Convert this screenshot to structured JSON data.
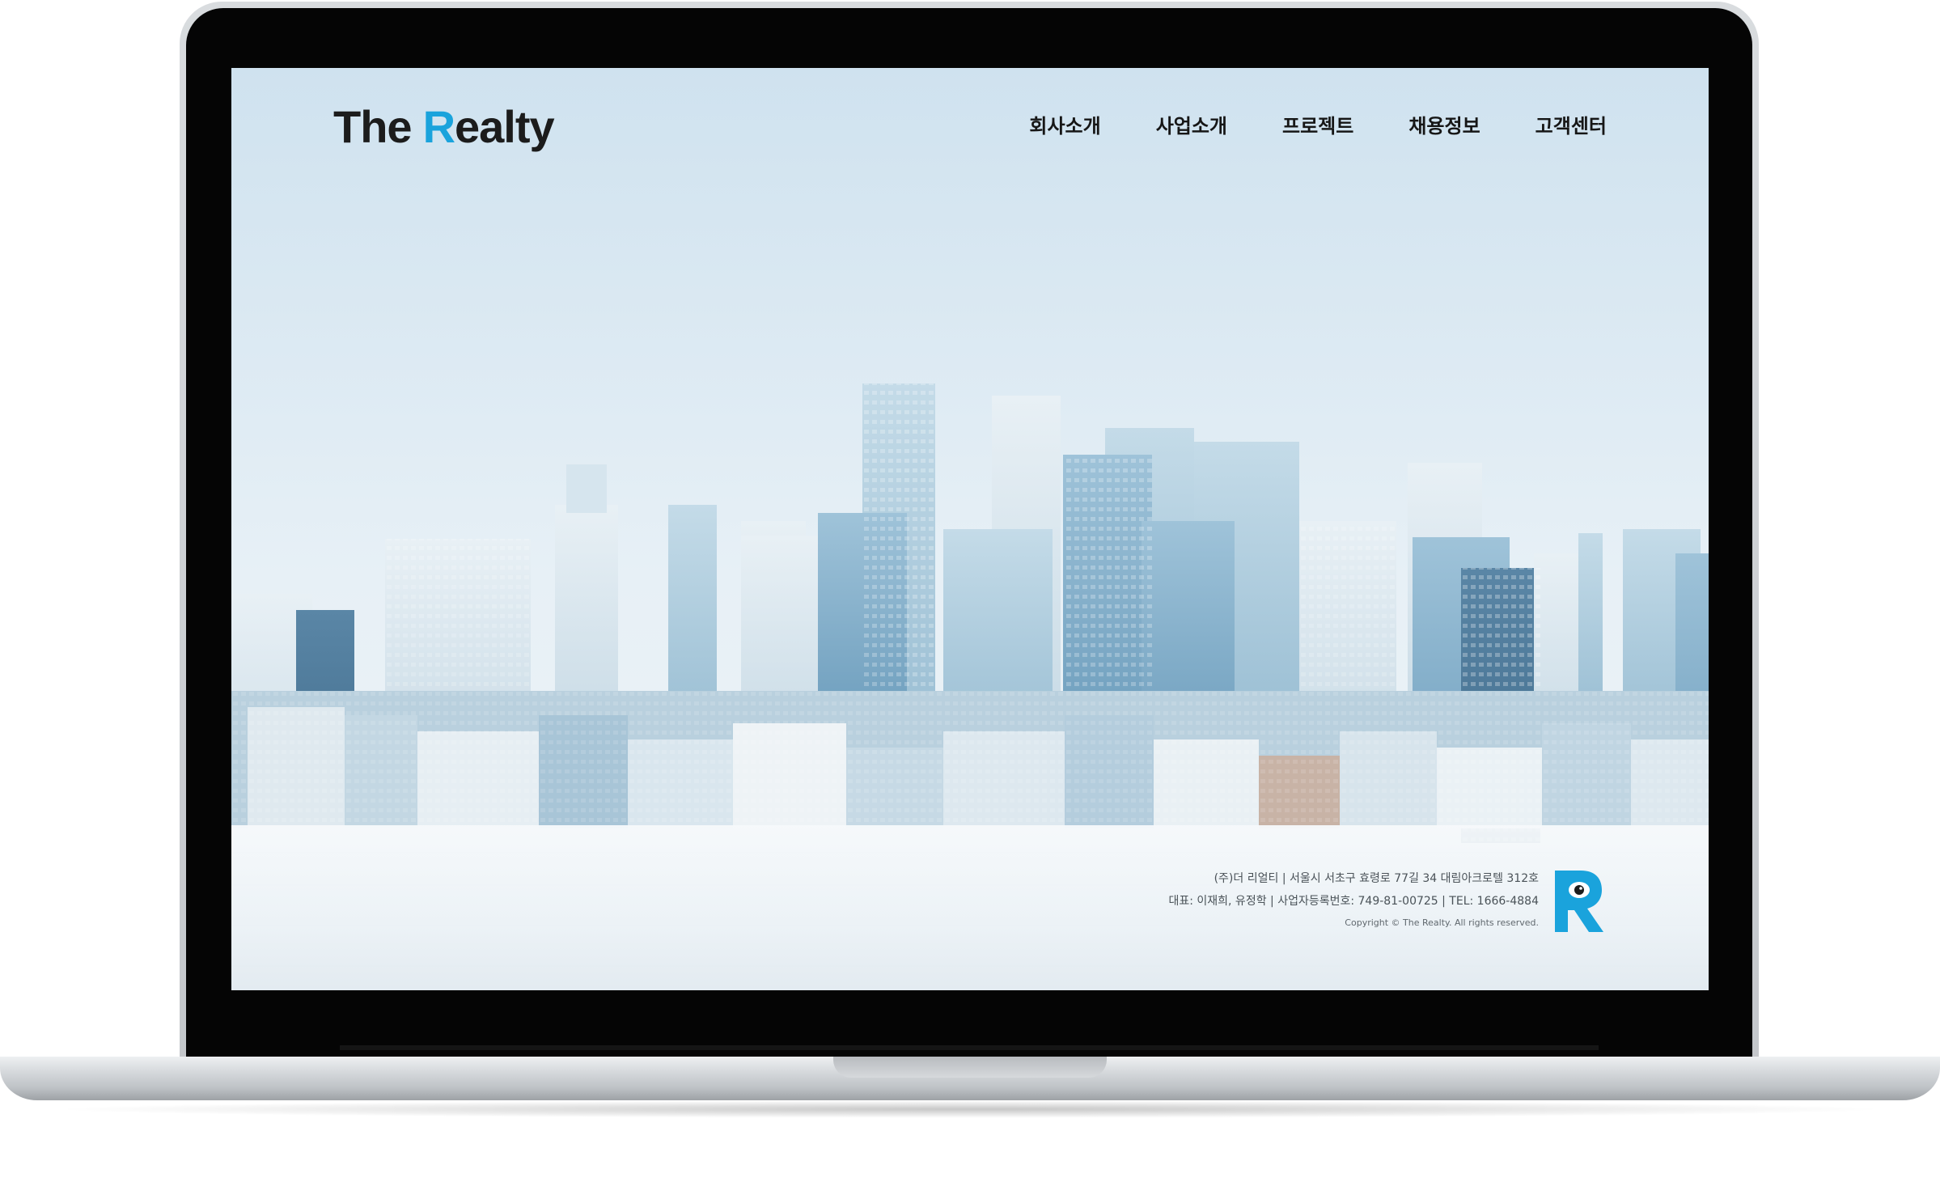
{
  "site": {
    "logo": {
      "part1": "The",
      "accent_letter": "R",
      "part2": "ealty",
      "accent_color": "#1aa3dc"
    },
    "nav": [
      {
        "label": "회사소개"
      },
      {
        "label": "사업소개"
      },
      {
        "label": "프로젝트"
      },
      {
        "label": "채용정보"
      },
      {
        "label": "고객센터"
      }
    ],
    "footer": {
      "line1": "(주)더 리얼티 | 서울시 서초구 효령로 77길 34 대림아크로텔 312호",
      "line2": "대표: 이재희, 유정학 | 사업자등록번호: 749-81-00725 | TEL: 1666-4884",
      "copyright": "Copyright © The Realty. All rights reserved.",
      "logo_letter": "R"
    }
  },
  "device": {
    "type": "laptop",
    "screen_background": "city-skyline-photo"
  }
}
